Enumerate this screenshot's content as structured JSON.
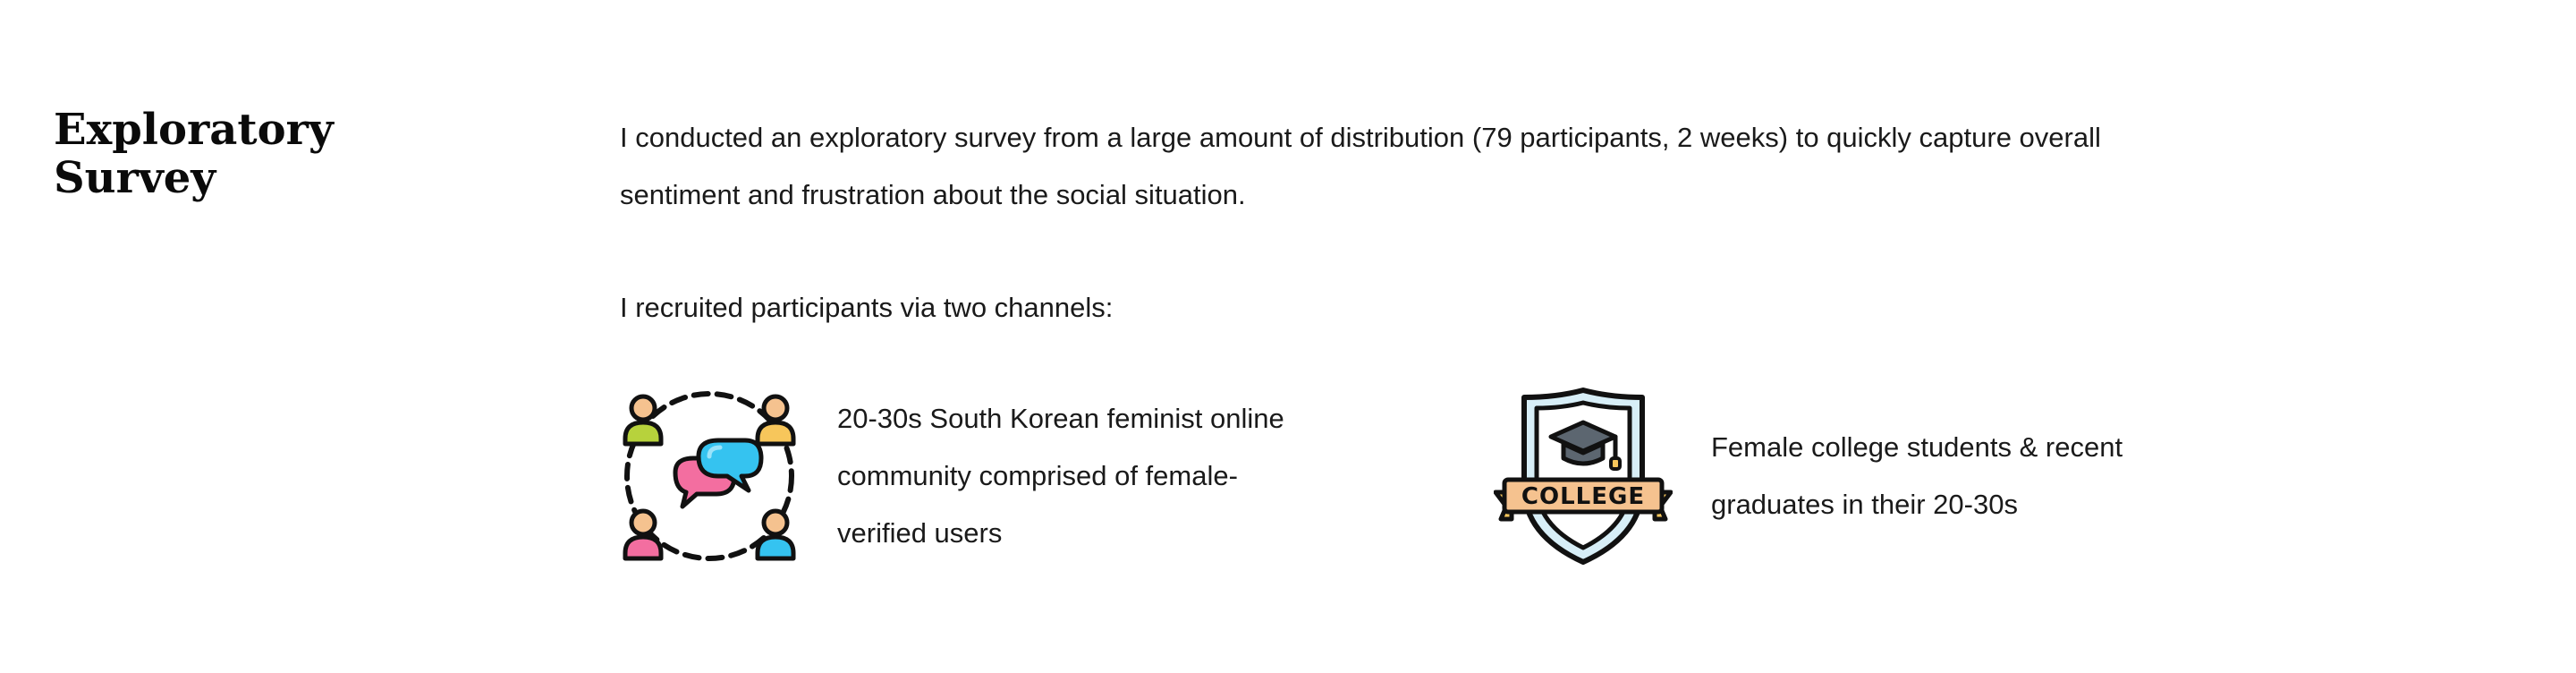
{
  "section": {
    "title": "Exploratory Survey"
  },
  "body": {
    "intro": "I conducted an exploratory survey from a large amount of distribution (79 participants, 2 weeks) to quickly capture overall sentiment and frustration about the social situation.",
    "recruit_lead": "I recruited participants via two channels:"
  },
  "channels": [
    {
      "icon": "community-chat-icon",
      "description": "20-30s South Korean feminist online community comprised of female-verified users"
    },
    {
      "icon": "college-shield-icon",
      "badge_text": "COLLEGE",
      "description": "Female college students & recent graduates in their 20-30s"
    }
  ],
  "colors": {
    "text": "#1a1a1a",
    "heading": "#0a0a0a",
    "accent_blue": "#35c3f0",
    "accent_pink": "#f36ea0",
    "accent_yellow": "#f7c65b",
    "accent_green": "#b7d23c",
    "skin": "#f5c28f",
    "shield_light": "#d7eef7",
    "cap_gray": "#5c6670"
  }
}
